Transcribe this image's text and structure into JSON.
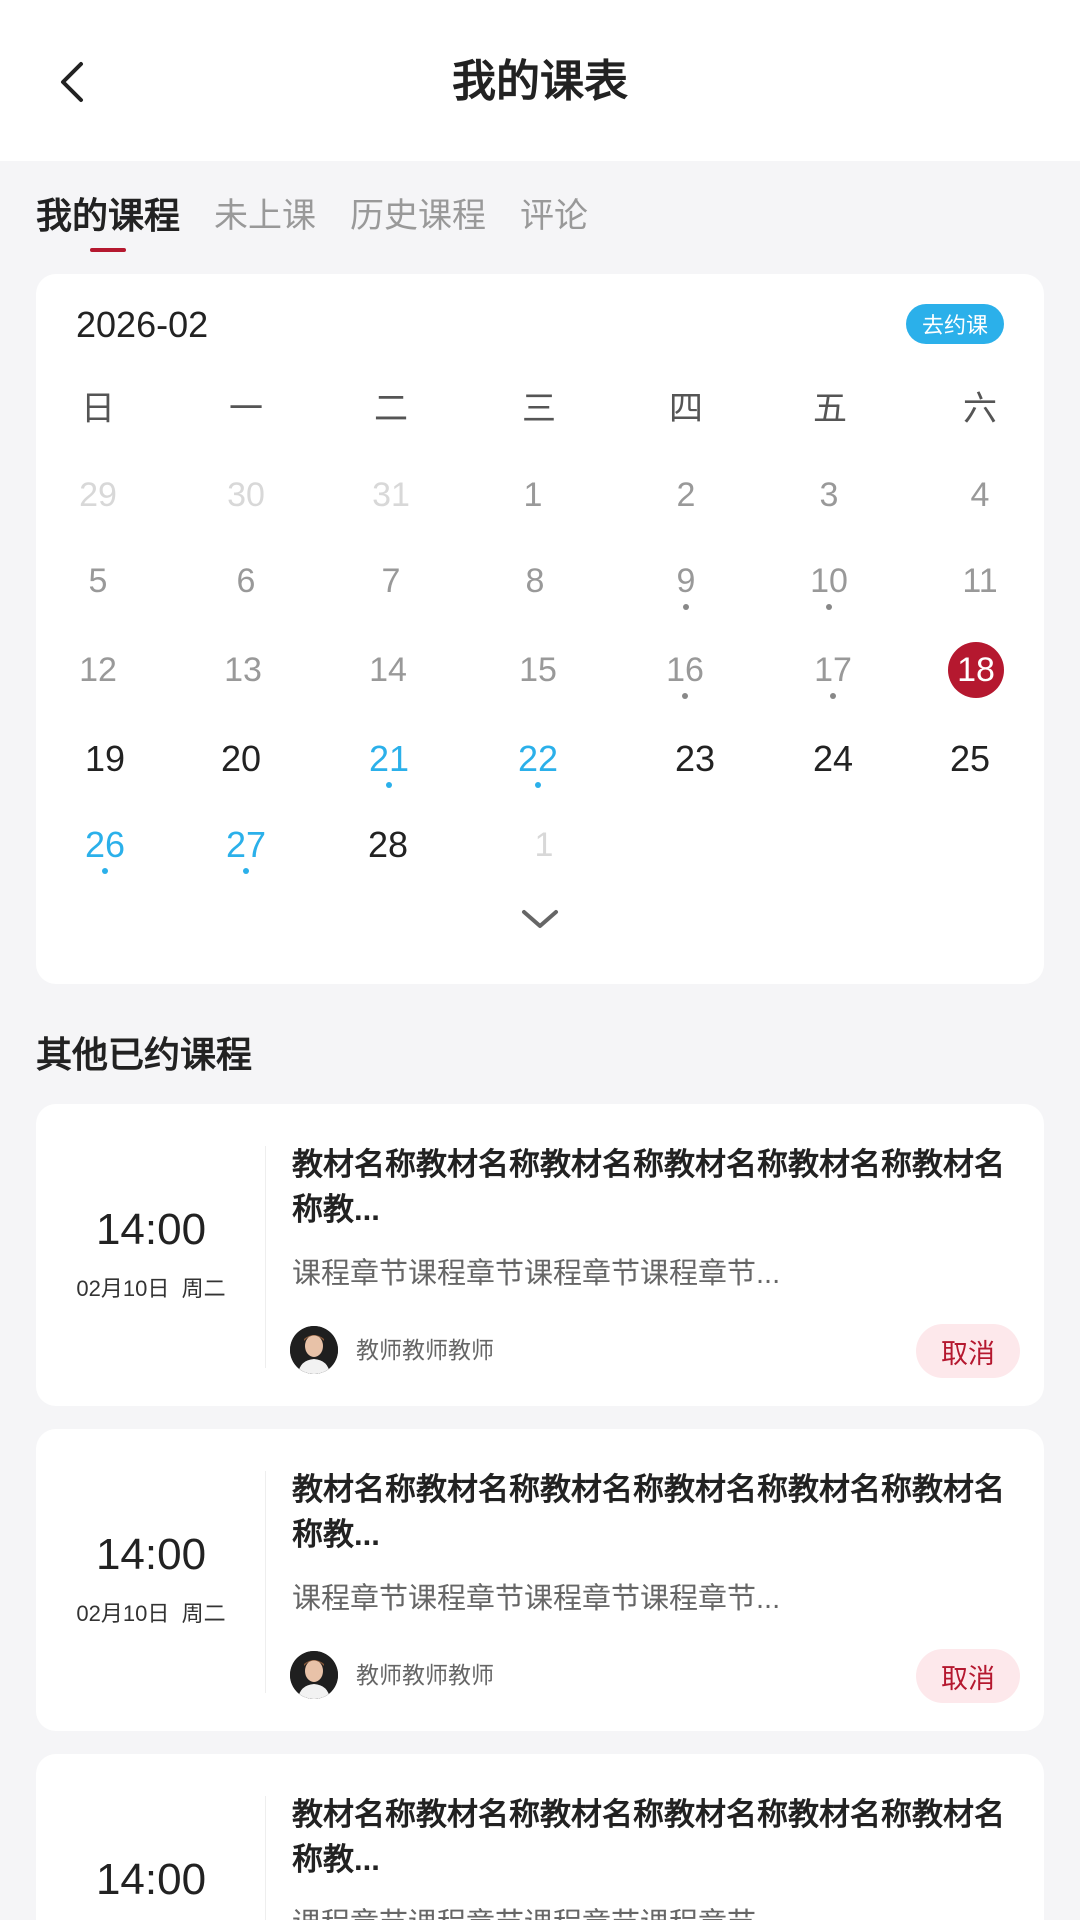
{
  "header": {
    "title": "我的课表"
  },
  "tabs": [
    {
      "label": "我的课程"
    },
    {
      "label": "未上课"
    },
    {
      "label": "历史课程"
    },
    {
      "label": "评论"
    }
  ],
  "calendar": {
    "month": "2026-02",
    "book_button": "去约课",
    "weekdays": [
      "日",
      "一",
      "二",
      "三",
      "四",
      "五",
      "六"
    ],
    "days": [
      "29",
      "30",
      "31",
      "1",
      "2",
      "3",
      "4",
      "5",
      "6",
      "7",
      "8",
      "9",
      "10",
      "11",
      "12",
      "13",
      "14",
      "15",
      "16",
      "17",
      "18",
      "19",
      "20",
      "21",
      "22",
      "23",
      "24",
      "25",
      "26",
      "27",
      "28",
      "1"
    ]
  },
  "section": {
    "title": "其他已约课程"
  },
  "courses": [
    {
      "time": "14:00",
      "date": "02月10日",
      "weekday": "周二",
      "title": "教材名称教材名称教材名称教材名称教材名称教材名称教...",
      "chapter": "课程章节课程章节课程章节课程章节...",
      "teacher": "教师教师教师",
      "cancel_label": "取消"
    },
    {
      "time": "14:00",
      "date": "02月10日",
      "weekday": "周二",
      "title": "教材名称教材名称教材名称教材名称教材名称教材名称教...",
      "chapter": "课程章节课程章节课程章节课程章节...",
      "teacher": "教师教师教师",
      "cancel_label": "取消"
    },
    {
      "time": "14:00",
      "title": "教材名称教材名称教材名称教材名称教材名称教材名称教...",
      "chapter": "课程章节课程章节课程章节课程章节..."
    }
  ],
  "colors": {
    "accent": "#b5182f",
    "booked_blue": "#2bb0ea",
    "cancel_bg": "#fde8eb",
    "page_bg": "#f5f5f7"
  },
  "icons": {
    "back": "chevron-left-icon",
    "expand": "chevron-down-icon",
    "avatar": "teacher-avatar"
  }
}
